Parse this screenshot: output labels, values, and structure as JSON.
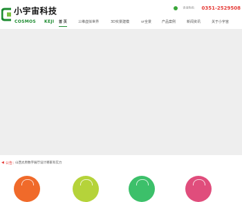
{
  "header": {
    "logo_cn": "小宇宙科技",
    "logo_en_left": "COSMOS",
    "logo_en_right": "KEJI",
    "hotline_label": "咨询热线：",
    "hotline_number": "0351-2529508"
  },
  "nav": {
    "items": [
      {
        "label": "首 页"
      },
      {
        "label": "三维虚拟世界"
      },
      {
        "label": "3D实景建模"
      },
      {
        "label": "vr全景"
      },
      {
        "label": "产品案例"
      },
      {
        "label": "新闻资讯"
      },
      {
        "label": "关于小宇宙"
      }
    ]
  },
  "notice": {
    "label": "公告：",
    "text": "山西太原数字展厅设计哪家有实力"
  },
  "colors": {
    "brand_green": "#1a8a2e",
    "hotline_red": "#e53935",
    "feature_1": "#f06a2a",
    "feature_2": "#b5d33a",
    "feature_3": "#3cc06a",
    "feature_4": "#e04d7c"
  }
}
